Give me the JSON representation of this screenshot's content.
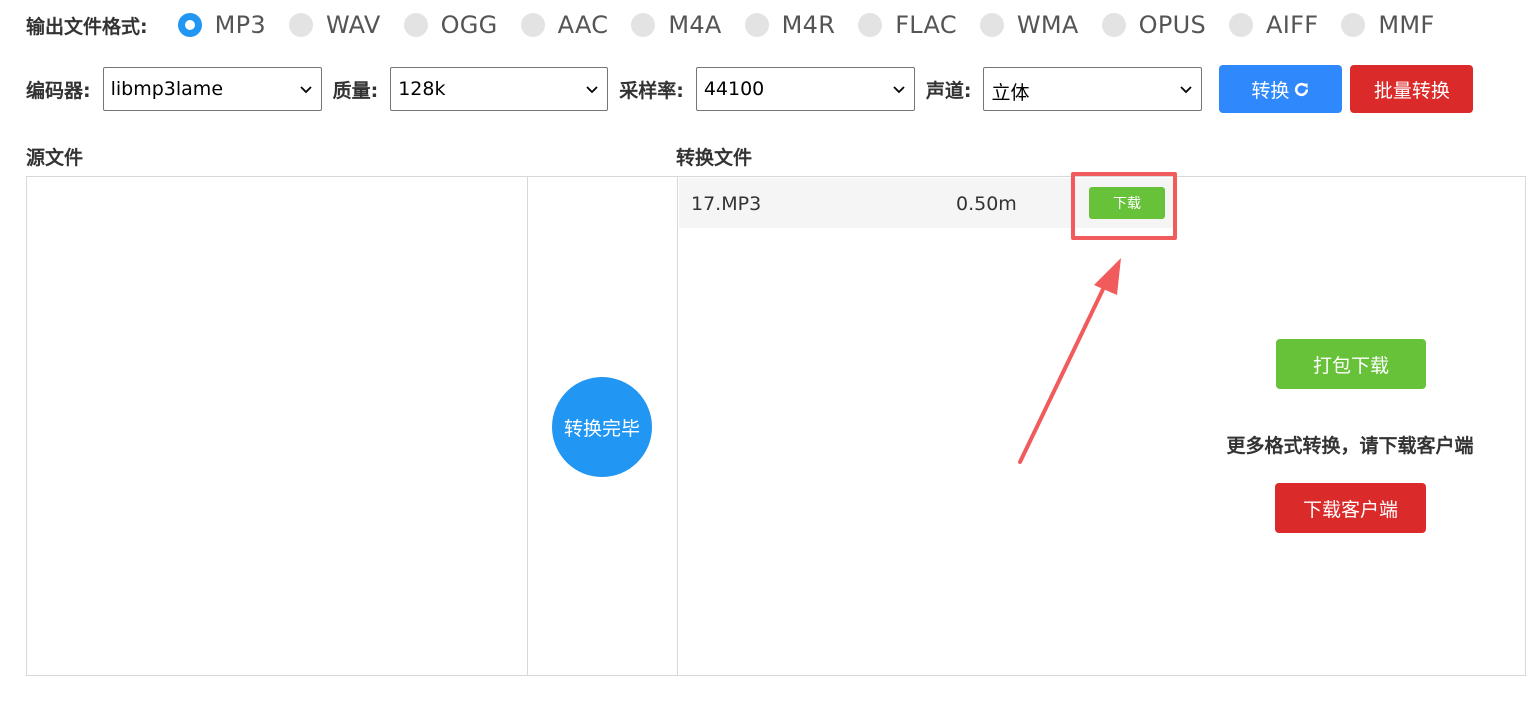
{
  "format": {
    "label": "输出文件格式:",
    "options": [
      "MP3",
      "WAV",
      "OGG",
      "AAC",
      "M4A",
      "M4R",
      "FLAC",
      "WMA",
      "OPUS",
      "AIFF",
      "MMF"
    ],
    "selected": "MP3"
  },
  "settings": {
    "encoder_label": "编码器:",
    "encoder_value": "libmp3lame",
    "quality_label": "质量:",
    "quality_value": "128k",
    "samplerate_label": "采样率:",
    "samplerate_value": "44100",
    "channel_label": "声道:",
    "channel_value": "立体",
    "convert_button": "转换",
    "batch_button": "批量转换"
  },
  "source": {
    "title": "源文件"
  },
  "status": {
    "done_label": "转换完毕"
  },
  "output": {
    "title": "转换文件",
    "files": [
      {
        "name": "17.MP3",
        "size": "0.50m",
        "download_label": "下载"
      }
    ]
  },
  "actions": {
    "pack_download": "打包下载",
    "more_formats": "更多格式转换，请下载客户端",
    "download_client": "下载客户端"
  },
  "colors": {
    "primary_blue": "#2196f3",
    "convert_blue": "#2f89fc",
    "danger_red": "#db2a2a",
    "success_green": "#67c23a",
    "annotation_red": "#f25b5b"
  },
  "icons": {
    "convert_icon": "refresh-icon",
    "select_icon": "chevron-down-icon"
  }
}
